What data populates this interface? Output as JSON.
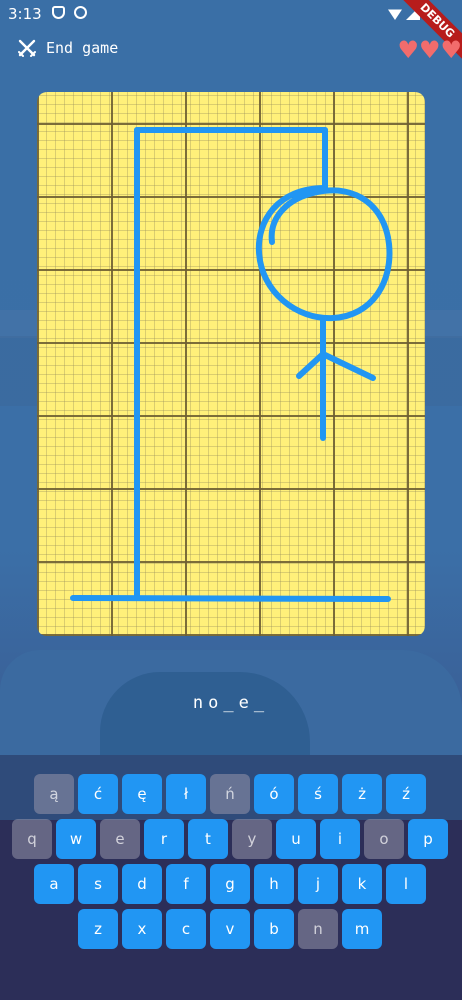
{
  "status_bar": {
    "time": "3:13",
    "debug_label": "DEBUG"
  },
  "header": {
    "end_game_label": "End game",
    "end_game_icon": "crossed-swords-icon",
    "lives": 3,
    "heart_icon": "heart-icon"
  },
  "game": {
    "word_display": "no_e_"
  },
  "colors": {
    "accent": "#2196f3",
    "key_used": "#8c94a8",
    "board": "#fff07a",
    "drawing": "#2196f3",
    "heart": "#f26c6c"
  },
  "keyboard": {
    "rows": [
      [
        {
          "label": "ą",
          "used": true
        },
        {
          "label": "ć",
          "used": false
        },
        {
          "label": "ę",
          "used": false
        },
        {
          "label": "ł",
          "used": false
        },
        {
          "label": "ń",
          "used": true
        },
        {
          "label": "ó",
          "used": false
        },
        {
          "label": "ś",
          "used": false
        },
        {
          "label": "ż",
          "used": false
        },
        {
          "label": "ź",
          "used": false
        }
      ],
      [
        {
          "label": "q",
          "used": true
        },
        {
          "label": "w",
          "used": false
        },
        {
          "label": "e",
          "used": true
        },
        {
          "label": "r",
          "used": false
        },
        {
          "label": "t",
          "used": false
        },
        {
          "label": "y",
          "used": true
        },
        {
          "label": "u",
          "used": false
        },
        {
          "label": "i",
          "used": false
        },
        {
          "label": "o",
          "used": true
        },
        {
          "label": "p",
          "used": false
        }
      ],
      [
        {
          "label": "a",
          "used": false
        },
        {
          "label": "s",
          "used": false
        },
        {
          "label": "d",
          "used": false
        },
        {
          "label": "f",
          "used": false
        },
        {
          "label": "g",
          "used": false
        },
        {
          "label": "h",
          "used": false
        },
        {
          "label": "j",
          "used": false
        },
        {
          "label": "k",
          "used": false
        },
        {
          "label": "l",
          "used": false
        }
      ],
      [
        {
          "label": "z",
          "used": false
        },
        {
          "label": "x",
          "used": false
        },
        {
          "label": "c",
          "used": false
        },
        {
          "label": "v",
          "used": false
        },
        {
          "label": "b",
          "used": false
        },
        {
          "label": "n",
          "used": true
        },
        {
          "label": "m",
          "used": false
        }
      ]
    ]
  }
}
